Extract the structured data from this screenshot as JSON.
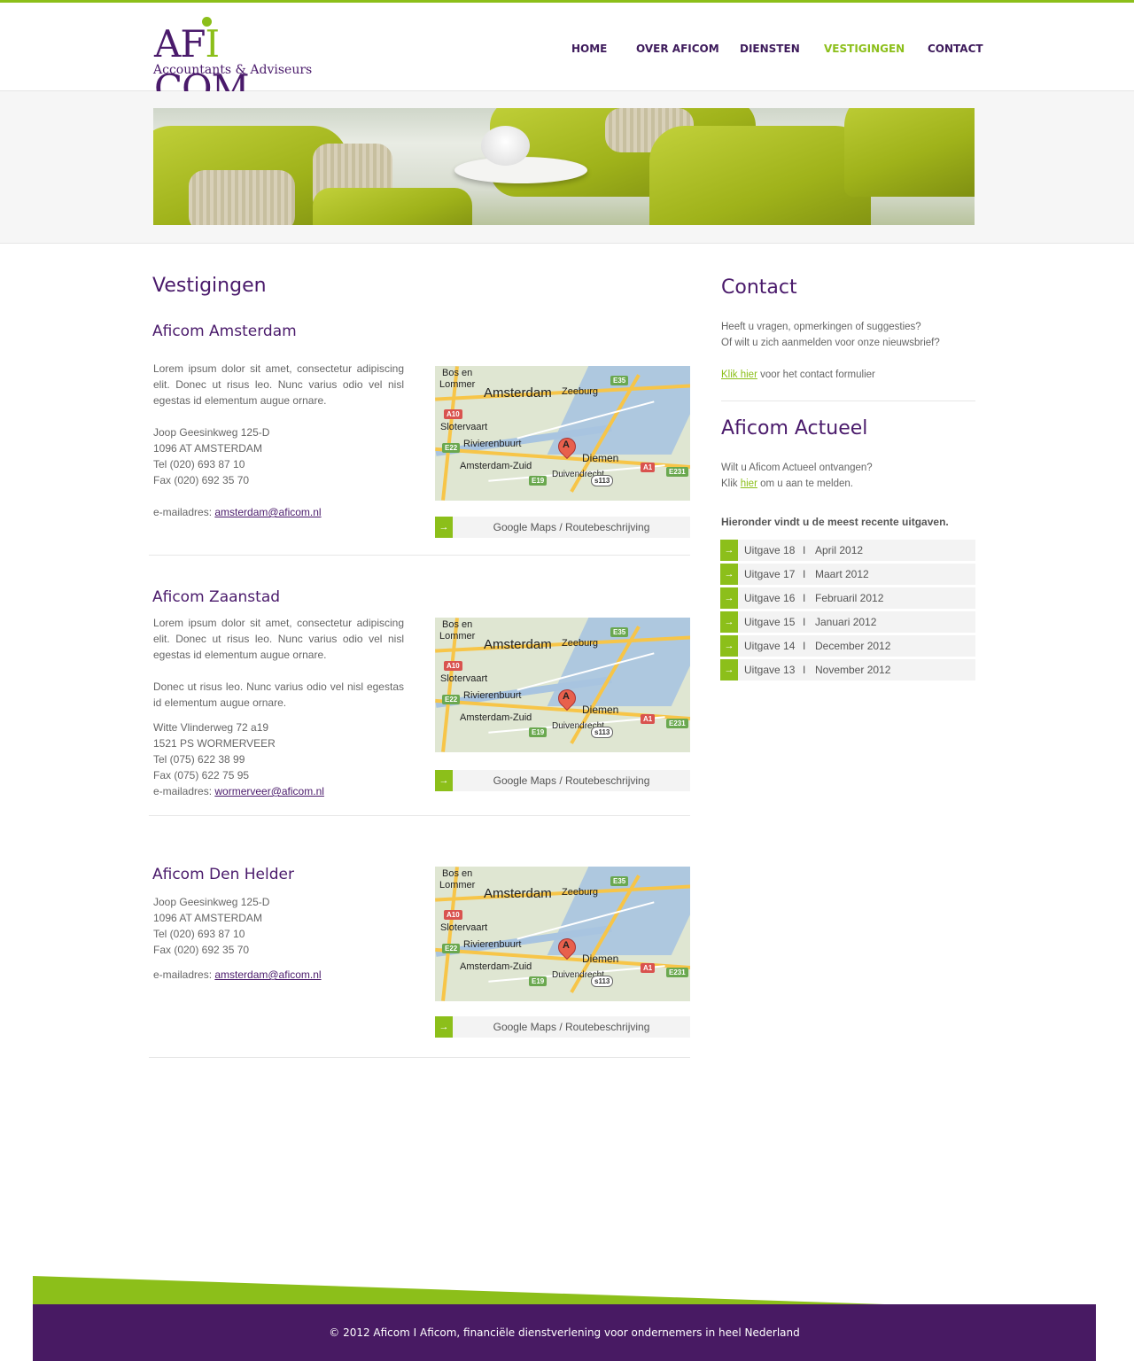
{
  "brand": {
    "name_prefix": "AF",
    "name_i": "I",
    "name_suffix": "COM",
    "tagline": "Accountants & Adviseurs",
    "accent_green": "#8cbf1a",
    "brand_purple": "#4a1a6b"
  },
  "nav": {
    "items": [
      {
        "label": "HOME",
        "active": false
      },
      {
        "label": "OVER AFICOM",
        "active": false
      },
      {
        "label": "DIENSTEN",
        "active": false
      },
      {
        "label": "VESTIGINGEN",
        "active": true
      },
      {
        "label": "CONTACT",
        "active": false
      }
    ]
  },
  "main": {
    "title": "Vestigingen",
    "locations": [
      {
        "title": "Aficom Amsterdam",
        "paragraphs": [
          "Lorem ipsum dolor sit amet, consectetur adipiscing elit. Donec ut risus leo. Nunc varius odio vel nisl egestas id elementum augue ornare."
        ],
        "address": [
          "Joop Geesinkweg 125-D",
          "1096 AT AMSTERDAM",
          "Tel (020) 693 87 10",
          "Fax (020) 692 35 70"
        ],
        "email_label": "e-mailadres: ",
        "email": "amsterdam@aficom.nl",
        "maps_button": "Google Maps / Routebeschrijving"
      },
      {
        "title": "Aficom Zaanstad",
        "paragraphs": [
          "Lorem ipsum dolor sit amet, consectetur adipiscing elit. Donec ut risus leo. Nunc varius odio vel nisl egestas id elementum augue ornare.",
          "Donec ut risus leo. Nunc varius odio vel nisl egestas id elementum augue ornare."
        ],
        "address": [
          "Witte Vlinderweg 72 a19",
          "1521 PS WORMERVEER",
          "Tel (075) 622 38 99",
          "Fax (075) 622 75 95"
        ],
        "email_label": "e-mailadres: ",
        "email": "wormerveer@aficom.nl",
        "maps_button": "Google Maps / Routebeschrijving"
      },
      {
        "title": "Aficom Den Helder",
        "paragraphs": [],
        "address": [
          "Joop Geesinkweg 125-D",
          "1096 AT AMSTERDAM",
          "Tel (020) 693 87 10",
          "Fax (020) 692 35 70"
        ],
        "email_label": "e-mailadres: ",
        "email": "amsterdam@aficom.nl",
        "maps_button": "Google Maps / Routebeschrijving"
      }
    ],
    "map_labels": {
      "bos": "Bos en",
      "lommer": "Lommer",
      "amsterdam": "Amsterdam",
      "zeeburg": "Zeeburg",
      "slotervaart": "Slotervaart",
      "rivierenbuurt": "Rivierenbuurt",
      "zuid": "Amsterdam-Zuid",
      "diemen": "Diemen",
      "duivendrecht": "Duivendrecht",
      "pin": "A",
      "e35": "E35",
      "a10": "A10",
      "e22": "E22",
      "e19": "E19",
      "a1": "A1",
      "e231": "E231",
      "s113": "s113"
    }
  },
  "sidebar": {
    "contact_title": "Contact",
    "contact_line1": "Heeft u vragen, opmerkingen of suggesties?",
    "contact_line2": "Of wilt u zich aanmelden voor onze nieuwsbrief?",
    "contact_link": "Klik hier",
    "contact_link_suffix": " voor het contact formulier",
    "actueel_title": "Aficom Actueel",
    "actueel_line1": "Wilt u Aficom Actueel ontvangen?",
    "actueel_prefix": "Klik ",
    "actueel_link": "hier",
    "actueel_suffix": " om u aan te melden.",
    "recent_heading": "Hieronder vindt u de meest recente uitgaven.",
    "separator": "I",
    "issues": [
      {
        "issue": "Uitgave 18",
        "date": "April 2012"
      },
      {
        "issue": "Uitgave 17",
        "date": "Maart 2012"
      },
      {
        "issue": "Uitgave 16",
        "date": "Februaril 2012"
      },
      {
        "issue": "Uitgave 15",
        "date": "Januari 2012"
      },
      {
        "issue": "Uitgave 14",
        "date": "December 2012"
      },
      {
        "issue": "Uitgave 13",
        "date": "November 2012"
      }
    ]
  },
  "footer": {
    "text": "© 2012 Aficom    I    Aficom, financiële dienstverlening voor ondernemers in heel Nederland"
  }
}
